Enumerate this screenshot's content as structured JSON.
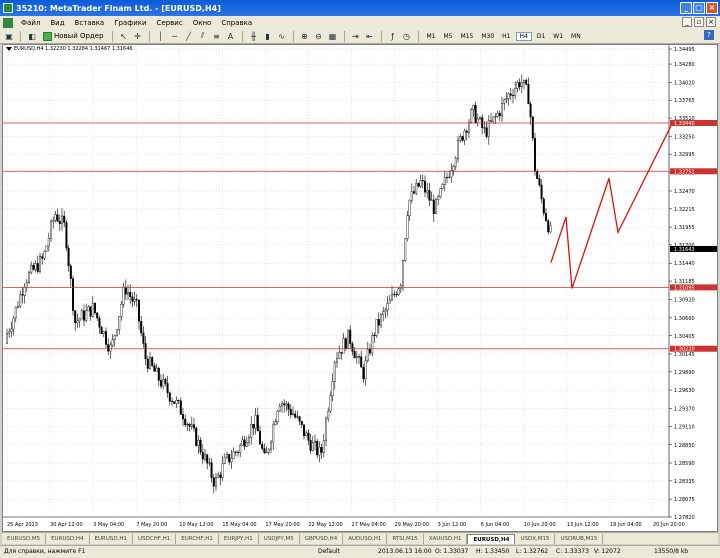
{
  "window": {
    "title": "35210: MetaTrader Finam Ltd. - [EURUSD,H4]",
    "min": "_",
    "max": "□",
    "close": "×"
  },
  "menu": {
    "items": [
      "Файл",
      "Вид",
      "Вставка",
      "Графики",
      "Сервис",
      "Окно",
      "Справка"
    ]
  },
  "toolbar": {
    "new_order": "Новый Ордер",
    "timeframes": [
      "M1",
      "M5",
      "M15",
      "M30",
      "H1",
      "H4",
      "D1",
      "W1",
      "MN"
    ],
    "active_timeframe": "H4",
    "help": "?"
  },
  "chart": {
    "symbol_info": "EURUSD,H4  1.32230 1.32284 1.31467 1.31646",
    "price_labels": [
      "1.34495",
      "1.34280",
      "1.34020",
      "1.33765",
      "1.33510",
      "1.33250",
      "1.32995",
      "1.32735",
      "1.32470",
      "1.32215",
      "1.31955",
      "1.31700",
      "1.31440",
      "1.31185",
      "1.30920",
      "1.30660",
      "1.30405",
      "1.30145",
      "1.29890",
      "1.29630",
      "1.29370",
      "1.29110",
      "1.28850",
      "1.28590",
      "1.28335",
      "1.28075",
      "1.27820"
    ],
    "hlines": [
      {
        "price": "1.33440",
        "color": "#cc3333"
      },
      {
        "price": "1.32751",
        "color": "#cc3333"
      },
      {
        "price": "1.31095",
        "color": "#cc3333"
      },
      {
        "price": "1.30220",
        "color": "#cc3333"
      }
    ],
    "current_price": "1.31643",
    "date_labels": [
      "25 Apr 2013",
      "30 Apr 12:00",
      "3 May 04:00",
      "7 May 20:00",
      "10 May 12:00",
      "15 May 04:00",
      "17 May 20:00",
      "22 May 12:00",
      "27 May 04:00",
      "29 May 20:00",
      "3 Jun 12:00",
      "6 Jun 04:00",
      "10 Jun 20:00",
      "13 Jun 12:00",
      "18 Jun 04:00",
      "20 Jun 20:00"
    ],
    "colors": {
      "background": "#ffffff",
      "candles": "#000000",
      "levels": "#cc3333",
      "projection": "#dd1111",
      "grid": "#c8c8c8"
    }
  },
  "tabs": [
    "EURUSD,M5",
    "EURUSD,H4",
    "EURUSD,H1",
    "USDCHF,H1",
    "EURCHF,H1",
    "EURJPY,H1",
    "USDJPY,M5",
    "GBPUSD,H4",
    "AUDUSD,H1",
    "RTSI,M15",
    "XAUUSD,H1",
    "EURUSD,H4",
    "USDX,M15",
    "USDRUB,M15"
  ],
  "active_tab": 11,
  "status": {
    "help": "Для справки, нажмите F1",
    "profile": "Default",
    "datetime": "2013.06.13 16:00",
    "open": "O: 1.33037",
    "high": "H: 1.33450",
    "low": "L: 1.32762",
    "close": "C: 1.33373",
    "volume": "V: 12072",
    "traffic": "13550/8 kb"
  }
}
